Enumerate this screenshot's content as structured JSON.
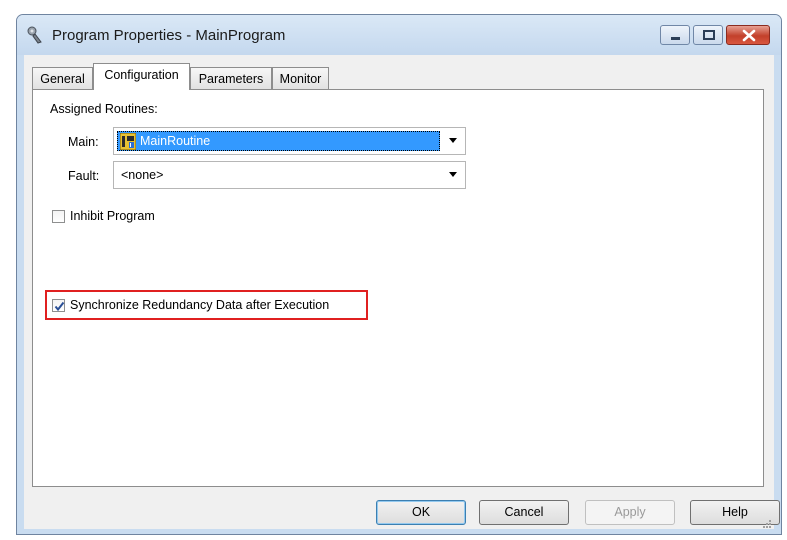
{
  "window": {
    "title": "Program Properties - MainProgram"
  },
  "tabs": [
    {
      "label": "General",
      "active": false
    },
    {
      "label": "Configuration",
      "active": true
    },
    {
      "label": "Parameters",
      "active": false
    },
    {
      "label": "Monitor",
      "active": false
    }
  ],
  "configuration": {
    "assigned_routines_label": "Assigned Routines:",
    "main": {
      "label": "Main:",
      "value": "MainRoutine",
      "icon": "routine-icon"
    },
    "fault": {
      "label": "Fault:",
      "value": "<none>"
    },
    "inhibit_program": {
      "label": "Inhibit Program",
      "checked": false
    },
    "synchronize_redundancy": {
      "label": "Synchronize Redundancy Data after Execution",
      "checked": true
    }
  },
  "buttons": {
    "ok": "OK",
    "cancel": "Cancel",
    "apply": "Apply",
    "help": "Help"
  },
  "colors": {
    "selection": "#3399ff",
    "highlight_box": "#e02020",
    "window_frame": "#c9dcf0"
  }
}
